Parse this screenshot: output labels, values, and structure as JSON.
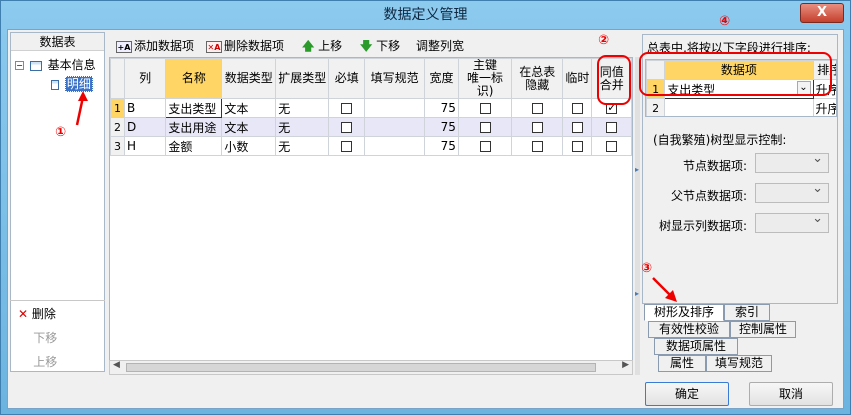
{
  "window": {
    "title": "数据定义管理",
    "close_label": "X"
  },
  "left": {
    "header": "数据表",
    "tree": {
      "root": "基本信息",
      "child": "明细"
    },
    "actions": {
      "delete": "删除",
      "down": "下移",
      "up": "上移"
    }
  },
  "toolbar": {
    "add": "添加数据项",
    "remove": "删除数据项",
    "up": "上移",
    "down": "下移",
    "adjust": "调整列宽"
  },
  "grid": {
    "headers": [
      "列",
      "名称",
      "数据类型",
      "扩展类型",
      "必填",
      "填写规范",
      "宽度",
      "主键\n唯一标识)",
      "在总表\n隐藏",
      "临时",
      "同值\n合并"
    ],
    "rows": [
      {
        "num": "1",
        "col": "B",
        "name": "支出类型",
        "type": "文本",
        "ext": "无",
        "width": "75",
        "merge": true
      },
      {
        "num": "2",
        "col": "D",
        "name": "支出用途",
        "type": "文本",
        "ext": "无",
        "width": "75",
        "merge": false
      },
      {
        "num": "3",
        "col": "H",
        "name": "金额",
        "type": "小数",
        "ext": "无",
        "width": "75",
        "merge": false
      }
    ]
  },
  "right": {
    "sort_title": "总表中,将按以下字段进行排序:",
    "sort_headers": {
      "field": "数据项",
      "order": "排序"
    },
    "sort_rows": [
      {
        "num": "1",
        "field": "支出类型",
        "order": "升序"
      },
      {
        "num": "2",
        "field": "",
        "order": "升序"
      }
    ],
    "tree_ctl": "(自我繁殖)树型显示控制:",
    "node_field": "节点数据项:",
    "parent_field": "父节点数据项:",
    "tree_col": "树显示列数据项:",
    "tabs": [
      "树形及排序",
      "索引",
      "有效性校验",
      "控制属性",
      "数据项属性",
      "属性",
      "填写规范"
    ]
  },
  "buttons": {
    "ok": "确定",
    "cancel": "取消"
  },
  "annotations": [
    "①",
    "②",
    "③",
    "④"
  ],
  "colors": {
    "annotation": "#e00000",
    "header_highlight": "#ffd666",
    "selection": "#3a72c8"
  }
}
